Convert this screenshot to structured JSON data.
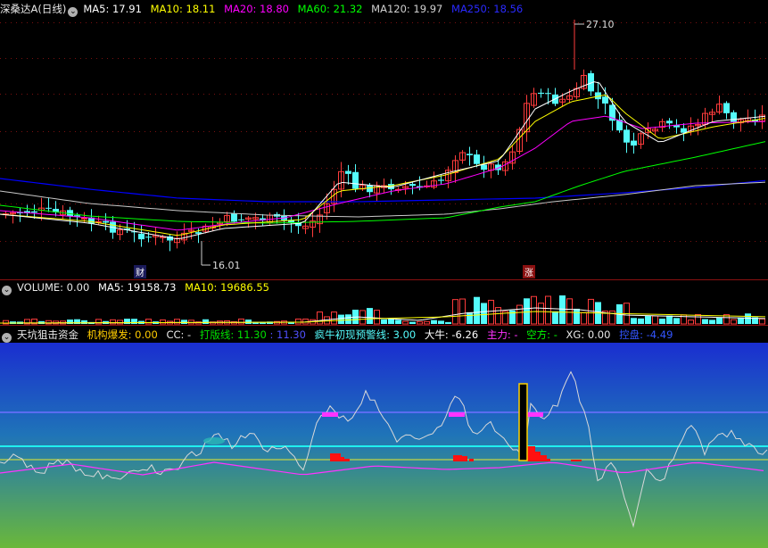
{
  "main_header": {
    "title": "深桑达A(日线)",
    "ma5": "MA5: 17.91",
    "ma10": "MA10: 18.11",
    "ma20": "MA20: 18.80",
    "ma60": "MA60: 21.32",
    "ma120": "MA120: 19.97",
    "ma250": "MA250: 18.56"
  },
  "price_annotations": {
    "high": "27.10",
    "low": "16.01",
    "badge_left": "财",
    "badge_right": "涨"
  },
  "volume_header": {
    "title": "VOLUME: 0.00",
    "ma5": "MA5: 19158.73",
    "ma10": "MA10: 19686.55"
  },
  "indicator_header": {
    "title": "天坑狙击资金",
    "jigou": "机构爆发: 0.00",
    "cc": "CC: -",
    "dabanxian_label": "打版线: 11.30",
    "dabanxian_value": ": 11.30",
    "fengniu": "疯牛初现预警线: 3.00",
    "daniu": "大牛: -6.26",
    "zhuli": "主力: -",
    "kongfang": "空方: -",
    "xg": "XG: 0.00",
    "kongpan": "控盘: -4.49"
  },
  "colors": {
    "ma5": "#ffffff",
    "ma10": "#ffff00",
    "ma20": "#ff00ff",
    "ma60": "#00ff00",
    "ma120": "#c8c8c8",
    "ma250": "#0000ff",
    "up": "#ff3c3c",
    "down": "#54fcfc",
    "separator": "#8a1010",
    "grid": "#7a1010"
  }
}
